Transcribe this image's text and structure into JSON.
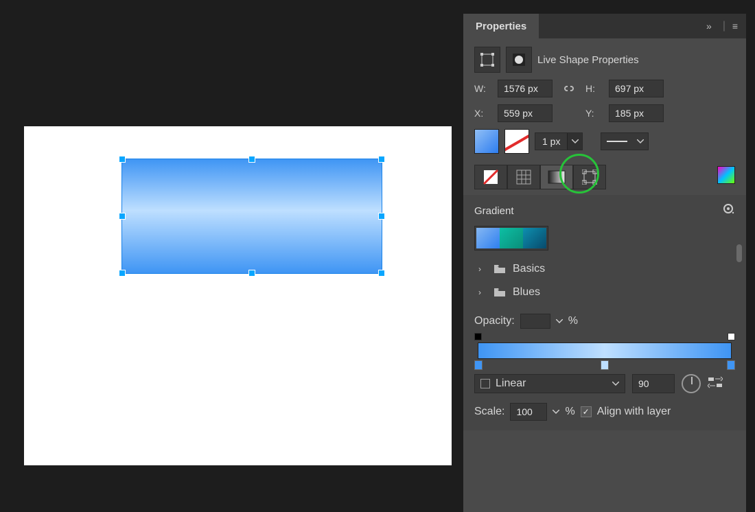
{
  "panel": {
    "title": "Properties",
    "section_title": "Live Shape Properties"
  },
  "dims": {
    "w_label": "W:",
    "w_value": "1576 px",
    "h_label": "H:",
    "h_value": "697 px",
    "x_label": "X:",
    "x_value": "559 px",
    "y_label": "Y:",
    "y_value": "185 px"
  },
  "stroke": {
    "width_value": "1 px"
  },
  "gradient": {
    "header": "Gradient",
    "folders": [
      "Basics",
      "Blues"
    ],
    "opacity_label": "Opacity:",
    "opacity_unit": "%",
    "type_label": "Linear",
    "angle_value": "90",
    "scale_label": "Scale:",
    "scale_value": "100",
    "scale_unit": "%",
    "align_label": "Align with layer"
  }
}
